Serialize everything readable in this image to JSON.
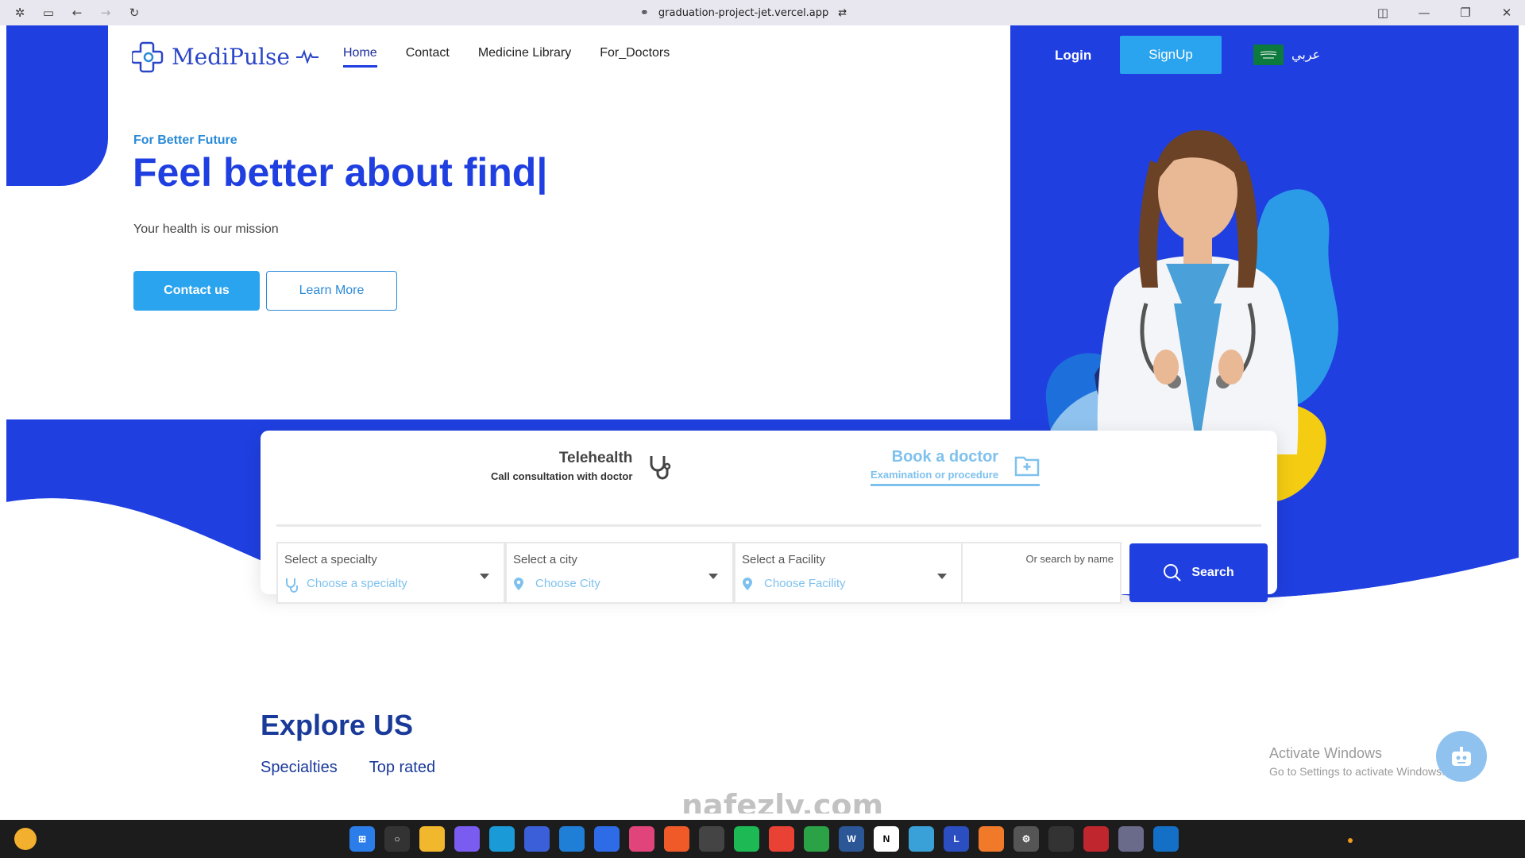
{
  "browser": {
    "url": "graduation-project-jet.vercel.app"
  },
  "brand": {
    "name": "MediPulse",
    "primary_color": "#1f3fe0",
    "accent_color": "#2aa4ee"
  },
  "nav": {
    "items": [
      {
        "label": "Home",
        "active": true
      },
      {
        "label": "Contact",
        "active": false
      },
      {
        "label": "Medicine Library",
        "active": false
      },
      {
        "label": "For_Doctors",
        "active": false
      }
    ]
  },
  "auth": {
    "login_label": "Login",
    "signup_label": "SignUp",
    "language_label": "عربي"
  },
  "hero": {
    "eyebrow": "For Better Future",
    "title": "Feel better about find|",
    "subtitle": "Your health is our mission",
    "contact_button": "Contact us",
    "learn_button": "Learn More"
  },
  "search_card": {
    "tabs": [
      {
        "title": "Telehealth",
        "subtitle": "Call consultation with doctor",
        "icon": "stethoscope-icon",
        "active": false
      },
      {
        "title": "Book a doctor",
        "subtitle": "Examination or procedure",
        "icon": "folder-plus-icon",
        "active": true
      }
    ],
    "fields": [
      {
        "label": "Select a specialty",
        "placeholder": "Choose a specialty",
        "icon": "stethoscope-icon"
      },
      {
        "label": "Select a city",
        "placeholder": "Choose City",
        "icon": "location-pin-icon"
      },
      {
        "label": "Select a Facility",
        "placeholder": "Choose Facility",
        "icon": "location-pin-icon"
      }
    ],
    "name_search_label": "Or search by name",
    "search_button": "Search"
  },
  "explore": {
    "title": "Explore US",
    "tabs": [
      "Specialties",
      "Top rated"
    ]
  },
  "os_overlay": {
    "activate_title": "Activate Windows",
    "activate_sub": "Go to Settings to activate Windows."
  },
  "watermark": "nafezly.com"
}
